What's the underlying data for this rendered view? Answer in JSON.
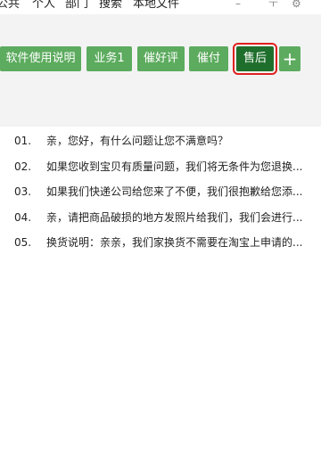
{
  "tabs": [
    "公共",
    "个人",
    "部门",
    "搜索",
    "本地文件"
  ],
  "window_controls": {
    "pin": "ㅜ",
    "settings": "⚙"
  },
  "toolbar": {
    "buttons": [
      "软件使用说明",
      "业务1",
      "催好评",
      "催付",
      "售后"
    ],
    "add_label": "+",
    "active_button": "售后"
  },
  "list": {
    "items": [
      {
        "num": "01.",
        "text": "亲，您好，有什么问题让您不满意吗？"
      },
      {
        "num": "02.",
        "text": "如果您收到宝贝有质量问题，我们将无条件为您退换..."
      },
      {
        "num": "03.",
        "text": "如果我们快递公司给您来了不便，我们很抱歉给您添..."
      },
      {
        "num": "04.",
        "text": "亲，请把商品破损的地方发照片给我们，我们会进行..."
      },
      {
        "num": "05.",
        "text": "换货说明：亲亲，我们家换货不需要在淘宝上申请的..."
      }
    ]
  },
  "colors": {
    "button_bg": "#5cab5e",
    "button_active_bg": "#1f6f2c",
    "highlight_border": "#e02020",
    "toolbar_bg": "#f3f3f3"
  }
}
